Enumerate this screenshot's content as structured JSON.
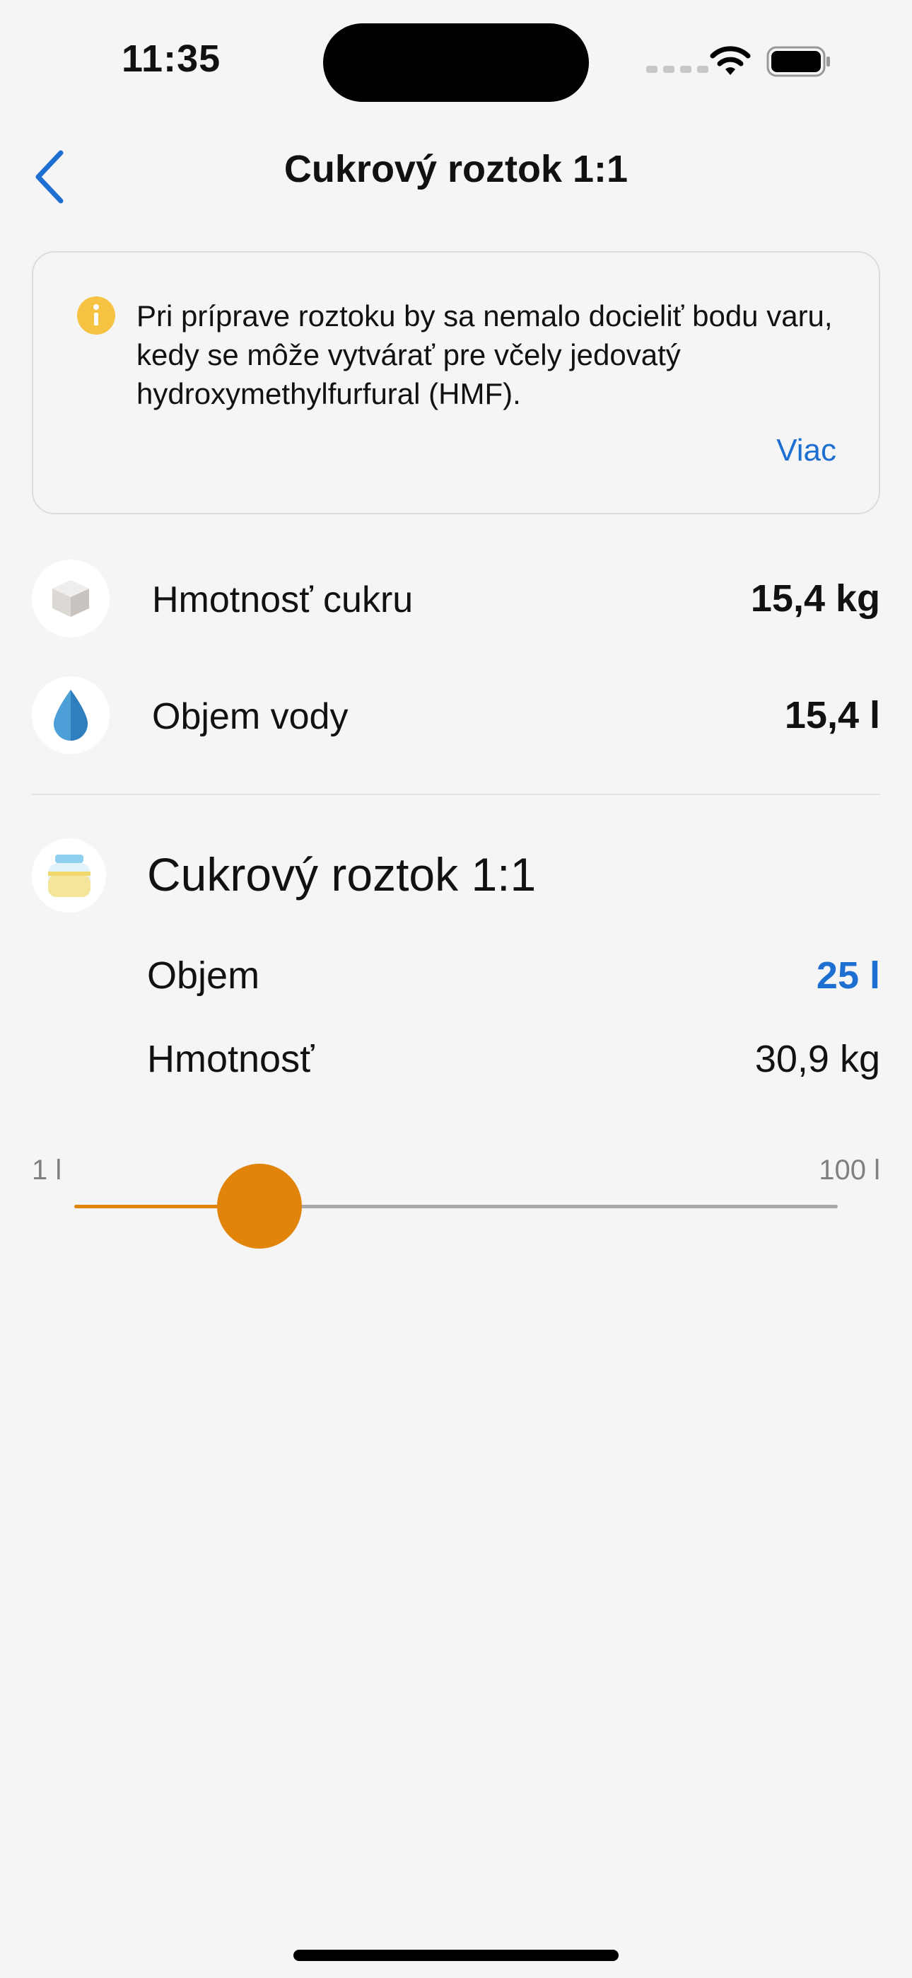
{
  "status_bar": {
    "time": "11:35"
  },
  "nav": {
    "title": "Cukrový roztok 1:1"
  },
  "info": {
    "text": "Pri príprave roztoku by sa nemalo docieliť bodu varu, kedy se môže vytvárať pre včely jedovatý hydroxymethylfurfural (HMF).",
    "more_label": "Viac",
    "icon_color": "#f5c242"
  },
  "ingredients": [
    {
      "label": "Hmotnosť cukru",
      "value": "15,4 kg",
      "icon": "sugar-cube-icon"
    },
    {
      "label": "Objem vody",
      "value": "15,4 l",
      "icon": "water-drop-icon"
    }
  ],
  "solution": {
    "title": "Cukrový roztok 1:1",
    "icon": "jar-icon",
    "volume_label": "Objem",
    "volume_value": "25 l",
    "weight_label": "Hmotnosť",
    "weight_value": "30,9 kg"
  },
  "slider": {
    "min_label": "1 l",
    "max_label": "100 l",
    "min": 1,
    "max": 100,
    "value": 25
  },
  "colors": {
    "accent": "#1d6fd1",
    "slider": "#e2830a",
    "background": "#f5f5f5"
  }
}
